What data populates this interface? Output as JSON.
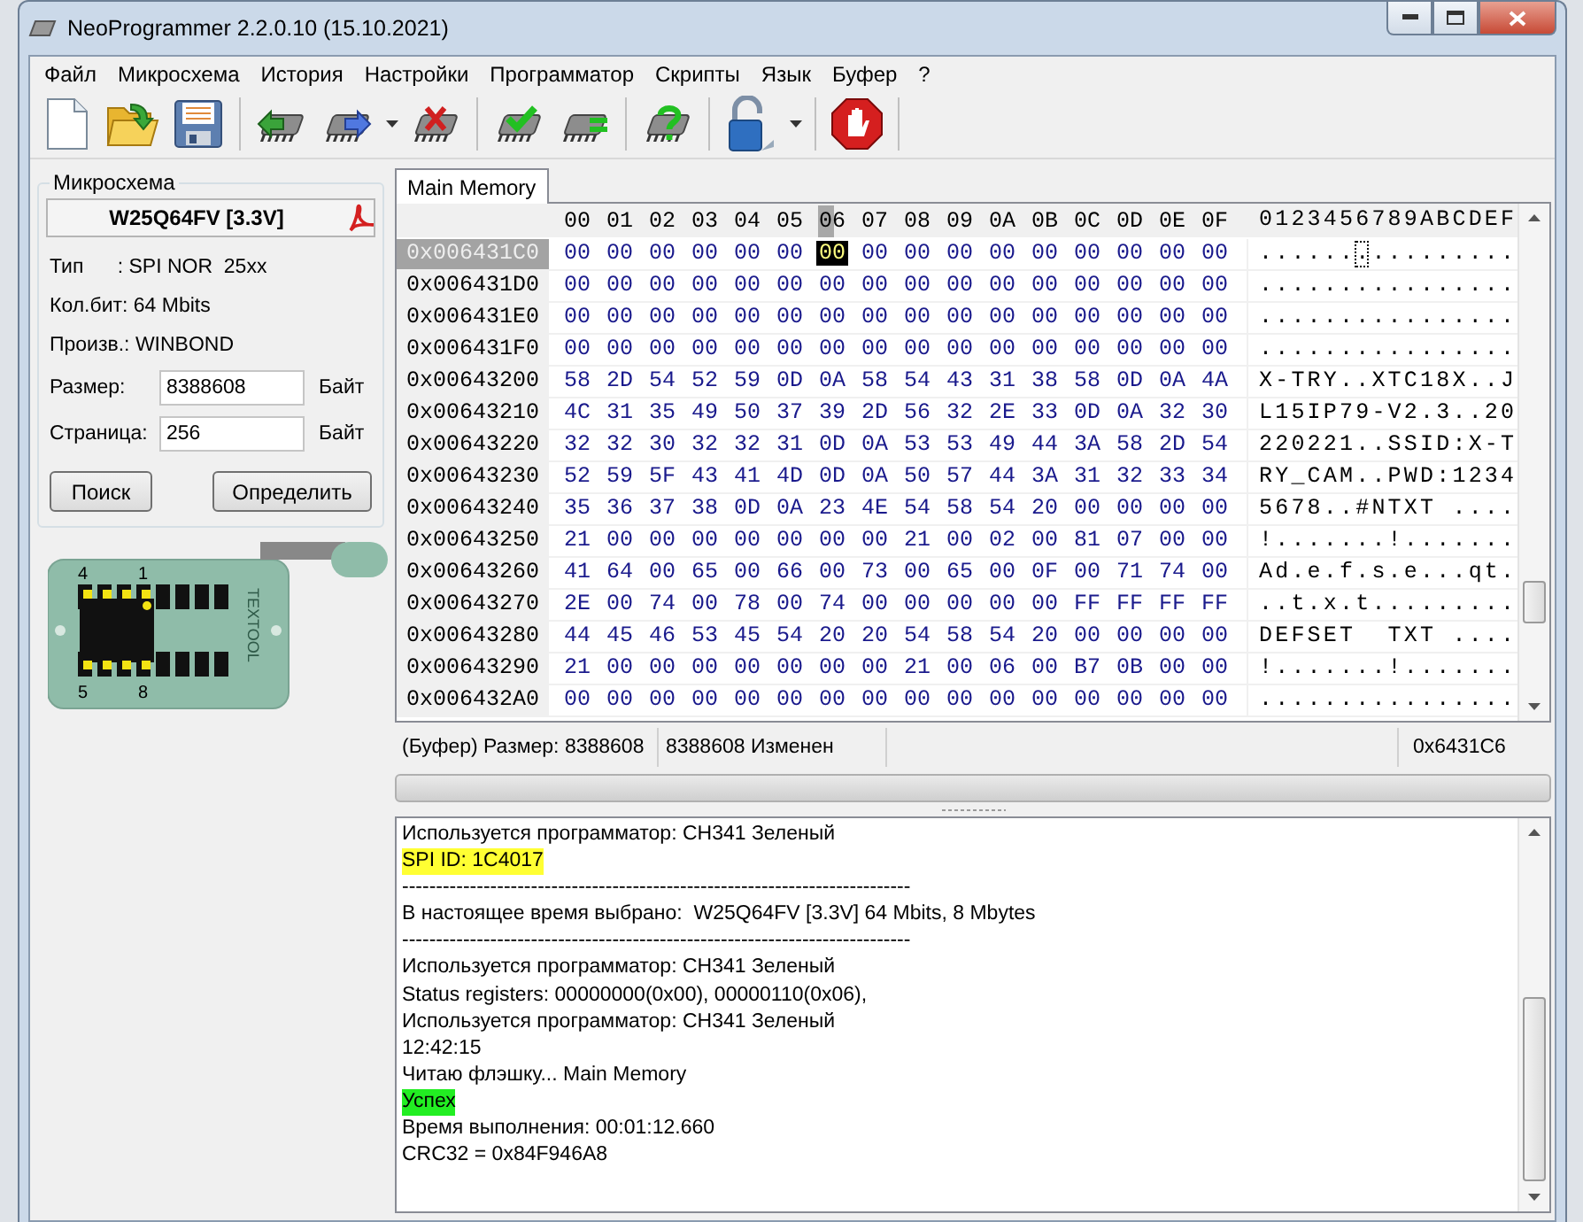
{
  "window": {
    "title": "NeoProgrammer 2.2.0.10 (15.10.2021)"
  },
  "menu": [
    "Файл",
    "Микросхема",
    "История",
    "Настройки",
    "Программатор",
    "Скрипты",
    "Язык",
    "Буфер",
    "?"
  ],
  "chip_panel": {
    "group_title": "Микросхема",
    "chip_name": "W25Q64FV [3.3V]",
    "info": [
      "Тип      : SPI NOR  25xx",
      "Кол.бит: 64 Mbits",
      "Произв.: WINBOND"
    ],
    "fields": [
      {
        "label": "Размер:",
        "value": "8388608",
        "unit": "Байт"
      },
      {
        "label": "Страница:",
        "value": "256",
        "unit": "Байт"
      }
    ],
    "buttons": [
      "Поиск",
      "Определить"
    ]
  },
  "socket": {
    "pin_labels": [
      "4",
      "1",
      "5",
      "8"
    ],
    "brand": "TEXTOOL"
  },
  "tabs": [
    {
      "label": "Main Memory",
      "selected": true
    }
  ],
  "hex_view": {
    "columns": [
      {
        "label": "00",
        "selected": false
      },
      {
        "label": "01",
        "selected": false
      },
      {
        "label": "02",
        "selected": false
      },
      {
        "label": "03",
        "selected": false
      },
      {
        "label": "04",
        "selected": false
      },
      {
        "label": "05",
        "selected": false
      },
      {
        "label": "06",
        "selected": true
      },
      {
        "label": "07",
        "selected": false
      },
      {
        "label": "08",
        "selected": false
      },
      {
        "label": "09",
        "selected": false
      },
      {
        "label": "0A",
        "selected": false
      },
      {
        "label": "0B",
        "selected": false
      },
      {
        "label": "0C",
        "selected": false
      },
      {
        "label": "0D",
        "selected": false
      },
      {
        "label": "0E",
        "selected": false
      },
      {
        "label": "0F",
        "selected": false
      }
    ],
    "ascii_header": "0123456789ABCDEF",
    "rows": [
      {
        "address": "0x006431C0",
        "selected": true,
        "bytes": [
          "00",
          "00",
          "00",
          "00",
          "00",
          "00",
          "00",
          "00",
          "00",
          "00",
          "00",
          "00",
          "00",
          "00",
          "00",
          "00"
        ],
        "ascii": "................"
      },
      {
        "address": "0x006431D0",
        "selected": false,
        "bytes": [
          "00",
          "00",
          "00",
          "00",
          "00",
          "00",
          "00",
          "00",
          "00",
          "00",
          "00",
          "00",
          "00",
          "00",
          "00",
          "00"
        ],
        "ascii": "................"
      },
      {
        "address": "0x006431E0",
        "selected": false,
        "bytes": [
          "00",
          "00",
          "00",
          "00",
          "00",
          "00",
          "00",
          "00",
          "00",
          "00",
          "00",
          "00",
          "00",
          "00",
          "00",
          "00"
        ],
        "ascii": "................"
      },
      {
        "address": "0x006431F0",
        "selected": false,
        "bytes": [
          "00",
          "00",
          "00",
          "00",
          "00",
          "00",
          "00",
          "00",
          "00",
          "00",
          "00",
          "00",
          "00",
          "00",
          "00",
          "00"
        ],
        "ascii": "................"
      },
      {
        "address": "0x00643200",
        "selected": false,
        "bytes": [
          "58",
          "2D",
          "54",
          "52",
          "59",
          "0D",
          "0A",
          "58",
          "54",
          "43",
          "31",
          "38",
          "58",
          "0D",
          "0A",
          "4A"
        ],
        "ascii": "X-TRY..XTC18X..J"
      },
      {
        "address": "0x00643210",
        "selected": false,
        "bytes": [
          "4C",
          "31",
          "35",
          "49",
          "50",
          "37",
          "39",
          "2D",
          "56",
          "32",
          "2E",
          "33",
          "0D",
          "0A",
          "32",
          "30"
        ],
        "ascii": "L15IP79-V2.3..20"
      },
      {
        "address": "0x00643220",
        "selected": false,
        "bytes": [
          "32",
          "32",
          "30",
          "32",
          "32",
          "31",
          "0D",
          "0A",
          "53",
          "53",
          "49",
          "44",
          "3A",
          "58",
          "2D",
          "54"
        ],
        "ascii": "220221..SSID:X-T"
      },
      {
        "address": "0x00643230",
        "selected": false,
        "bytes": [
          "52",
          "59",
          "5F",
          "43",
          "41",
          "4D",
          "0D",
          "0A",
          "50",
          "57",
          "44",
          "3A",
          "31",
          "32",
          "33",
          "34"
        ],
        "ascii": "RY_CAM..PWD:1234"
      },
      {
        "address": "0x00643240",
        "selected": false,
        "bytes": [
          "35",
          "36",
          "37",
          "38",
          "0D",
          "0A",
          "23",
          "4E",
          "54",
          "58",
          "54",
          "20",
          "00",
          "00",
          "00",
          "00"
        ],
        "ascii": "5678..#NTXT ...."
      },
      {
        "address": "0x00643250",
        "selected": false,
        "bytes": [
          "21",
          "00",
          "00",
          "00",
          "00",
          "00",
          "00",
          "00",
          "21",
          "00",
          "02",
          "00",
          "81",
          "07",
          "00",
          "00"
        ],
        "ascii": "!.......!......."
      },
      {
        "address": "0x00643260",
        "selected": false,
        "bytes": [
          "41",
          "64",
          "00",
          "65",
          "00",
          "66",
          "00",
          "73",
          "00",
          "65",
          "00",
          "0F",
          "00",
          "71",
          "74",
          "00"
        ],
        "ascii": "Ad.e.f.s.e...qt."
      },
      {
        "address": "0x00643270",
        "selected": false,
        "bytes": [
          "2E",
          "00",
          "74",
          "00",
          "78",
          "00",
          "74",
          "00",
          "00",
          "00",
          "00",
          "00",
          "FF",
          "FF",
          "FF",
          "FF"
        ],
        "ascii": "..t.x.t........."
      },
      {
        "address": "0x00643280",
        "selected": false,
        "bytes": [
          "44",
          "45",
          "46",
          "53",
          "45",
          "54",
          "20",
          "20",
          "54",
          "58",
          "54",
          "20",
          "00",
          "00",
          "00",
          "00"
        ],
        "ascii": "DEFSET  TXT ...."
      },
      {
        "address": "0x00643290",
        "selected": false,
        "bytes": [
          "21",
          "00",
          "00",
          "00",
          "00",
          "00",
          "00",
          "00",
          "21",
          "00",
          "06",
          "00",
          "B7",
          "0B",
          "00",
          "00"
        ],
        "ascii": "!.......!......."
      },
      {
        "address": "0x006432A0",
        "selected": false,
        "bytes": [
          "00",
          "00",
          "00",
          "00",
          "00",
          "00",
          "00",
          "00",
          "00",
          "00",
          "00",
          "00",
          "00",
          "00",
          "00",
          "00"
        ],
        "ascii": "................"
      }
    ]
  },
  "status_bar": [
    "(Буфер) Размер: 8388608",
    "8388608 Изменен",
    "0x6431C6"
  ],
  "log": [
    {
      "text": "Используется программатор: CH341 Зеленый"
    },
    {
      "text": "SPI ID: 1C4017",
      "color": "#ffff33"
    },
    {
      "text": "---------------------------------------------------------------------------"
    },
    {
      "text": "В настоящее время выбрано:  W25Q64FV [3.3V] 64 Mbits, 8 Mbytes"
    },
    {
      "text": "---------------------------------------------------------------------------"
    },
    {
      "text": "Используется программатор: CH341 Зеленый"
    },
    {
      "text": "Status registers: 00000000(0x00), 00000110(0x06),"
    },
    {
      "text": "Используется программатор: CH341 Зеленый"
    },
    {
      "text": "12:42:15"
    },
    {
      "text": "Читаю флэшку... Main Memory"
    },
    {
      "text": "Успех",
      "color": "#22ee22"
    },
    {
      "text": "Время выполнения: 00:01:12.660"
    },
    {
      "text": "CRC32 = 0x84F946A8"
    }
  ]
}
